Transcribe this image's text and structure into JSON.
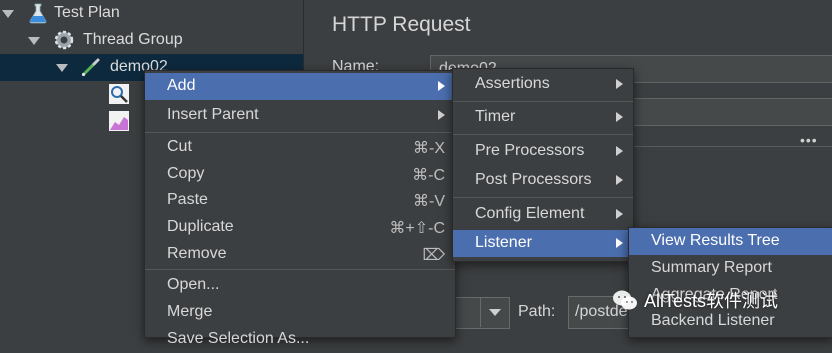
{
  "tree": {
    "items": [
      {
        "label": "Test Plan",
        "icon": "flask-icon"
      },
      {
        "label": "Thread Group",
        "icon": "gear-icon"
      },
      {
        "label": "demo02",
        "icon": "pipette-icon"
      },
      {
        "label": "",
        "icon": "magnifier-icon"
      },
      {
        "label": "",
        "icon": "graph-icon"
      }
    ]
  },
  "panel": {
    "title": "HTTP Request",
    "name_label": "Name:",
    "name_value": "demo02",
    "more_icon": "•••",
    "path_label": "Path:",
    "path_value": "/postde"
  },
  "context_menu": {
    "items": [
      {
        "label": "Add",
        "shortcut": "",
        "submenu": true,
        "highlighted": true
      },
      {
        "label": "Insert Parent",
        "shortcut": "",
        "submenu": true,
        "highlighted": false
      },
      {
        "label": "Cut",
        "shortcut": "⌘-X",
        "submenu": false,
        "highlighted": false
      },
      {
        "label": "Copy",
        "shortcut": "⌘-C",
        "submenu": false,
        "highlighted": false
      },
      {
        "label": "Paste",
        "shortcut": "⌘-V",
        "submenu": false,
        "highlighted": false
      },
      {
        "label": "Duplicate",
        "shortcut": "⌘+⇧-C",
        "submenu": false,
        "highlighted": false
      },
      {
        "label": "Remove",
        "shortcut": "⌦",
        "submenu": false,
        "highlighted": false
      },
      {
        "label": "Open...",
        "shortcut": "",
        "submenu": false,
        "highlighted": false
      },
      {
        "label": "Merge",
        "shortcut": "",
        "submenu": false,
        "highlighted": false
      },
      {
        "label": "Save Selection As...",
        "shortcut": "",
        "submenu": false,
        "highlighted": false
      }
    ]
  },
  "add_menu": {
    "items": [
      {
        "label": "Assertions",
        "highlighted": false
      },
      {
        "label": "Timer",
        "highlighted": false
      },
      {
        "label": "Pre Processors",
        "highlighted": false
      },
      {
        "label": "Post Processors",
        "highlighted": false
      },
      {
        "label": "Config Element",
        "highlighted": false
      },
      {
        "label": "Listener",
        "highlighted": true
      }
    ]
  },
  "listener_menu": {
    "items": [
      {
        "label": "View Results Tree",
        "highlighted": true
      },
      {
        "label": "Summary Report",
        "highlighted": false
      },
      {
        "label": "Aggregate Report",
        "highlighted": false
      },
      {
        "label": "Backend Listener",
        "highlighted": false
      }
    ]
  },
  "watermark": {
    "text": "AllTests软件测试"
  },
  "colors": {
    "background": "#3c3f41",
    "highlight": "#4b6eaf",
    "tree_selection": "#0d293e"
  }
}
